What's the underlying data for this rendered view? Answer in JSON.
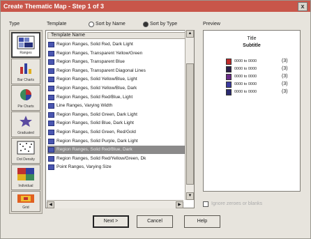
{
  "window": {
    "title": "Create Thematic Map - Step 1 of 3",
    "close_symbol": "x"
  },
  "labels": {
    "type": "Type",
    "template": "Template",
    "preview": "Preview"
  },
  "sort": {
    "by_name": "Sort by Name",
    "by_type": "Sort by Type"
  },
  "types": [
    {
      "caption": "Ranges",
      "icon": "ranges-icon"
    },
    {
      "caption": "Bar Charts",
      "icon": "bar-chart-icon"
    },
    {
      "caption": "Pie Charts",
      "icon": "pie-chart-icon"
    },
    {
      "caption": "Graduated",
      "icon": "graduated-icon"
    },
    {
      "caption": "Dot Density",
      "icon": "dot-density-icon"
    },
    {
      "caption": "Individual",
      "icon": "individual-icon"
    },
    {
      "caption": "Grid",
      "icon": "grid-icon"
    }
  ],
  "template_list": {
    "header": "Template Name",
    "rows": [
      "Region Ranges, Solid Red, Dark Light",
      "Region Ranges, Transparent Yellow/Green",
      "Region Ranges, Transparent Blue",
      "Region Ranges, Transparent Diagonal Lines",
      "Region Ranges, Solid Yellow/Blue, Light",
      "Region Ranges, Solid Yellow/Blue, Dark",
      "Region Ranges, Solid Red/Blue, Light",
      "Line Ranges, Varying Width",
      "Region Ranges, Solid Green, Dark Light",
      "Region Ranges, Solid Blue, Dark Light",
      "Region Ranges, Solid Green, Red/Gold",
      "Region Ranges, Solid Purple, Dark Light",
      "Region Ranges, Solid Red/Blue, Dark",
      "Region Ranges, Solid Red/Yellow/Green, Dk",
      "Point Ranges, Varying Size"
    ],
    "selected_index": 12
  },
  "preview": {
    "title": "Title",
    "subtitle": "Subtitle",
    "legend": [
      {
        "color": "#c02a2a",
        "label": "0000 to 0000",
        "sym": "(3)"
      },
      {
        "color": "#2a1f4a",
        "label": "0000 to 0000",
        "sym": "(3)"
      },
      {
        "color": "#6a2a8a",
        "label": "0000 to 0000",
        "sym": "(3)"
      },
      {
        "color": "#3a3aa0",
        "label": "0000 to 0000",
        "sym": "(3)"
      },
      {
        "color": "#2a2a70",
        "label": "0000 to 0000",
        "sym": "(3)"
      }
    ]
  },
  "options": {
    "ignore_zero_label": "Ignore zeroes or blanks"
  },
  "buttons": {
    "next": "Next >",
    "cancel": "Cancel",
    "help": "Help"
  }
}
